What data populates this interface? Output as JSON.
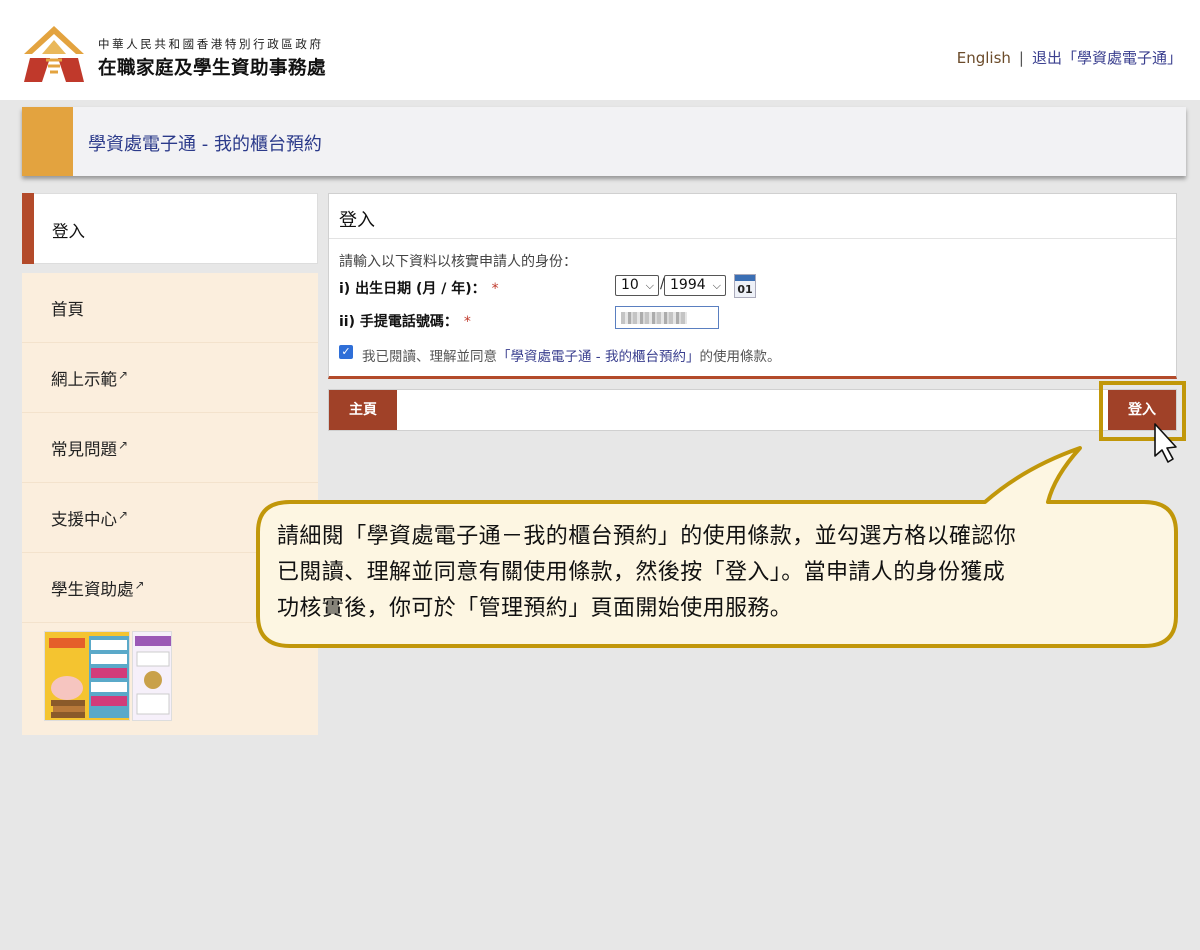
{
  "header": {
    "org_top": "中華人民共和國香港特別行政區政府",
    "org_main": "在職家庭及學生資助事務處",
    "lang_link": "English",
    "separator": "|",
    "logout_link": "退出「學資處電子通」"
  },
  "title_bar": {
    "title": "學資處電子通 - 我的櫃台預約"
  },
  "sidebar": {
    "active_item": "登入",
    "items": [
      {
        "label": "首頁",
        "external": false
      },
      {
        "label": "網上示範",
        "external": true
      },
      {
        "label": "常見問題",
        "external": true
      },
      {
        "label": "支援中心",
        "external": true
      },
      {
        "label": "學生資助處",
        "external": true
      }
    ],
    "external_icon": "external-link-icon"
  },
  "login": {
    "heading": "登入",
    "instruction": "請輸入以下資料以核實申請人的身份：",
    "dob_label": "i) 出生日期 (月 / 年)：",
    "required_mark": "*",
    "month_value": "10",
    "slash": "/",
    "year_value": "1994",
    "calendar_day": "01",
    "phone_label": "ii) 手提電話號碼：",
    "checkbox_checked": true,
    "agree_prefix": "我已閱讀、理解並同意",
    "agree_link": "「學資處電子通 - 我的櫃台預約」",
    "agree_suffix": "的使用條款。"
  },
  "actions": {
    "home_button": "主頁",
    "login_button": "登入"
  },
  "callout": {
    "lines": [
      "請細閱「學資處電子通－我的櫃台預約」的使用條款，並勾選方格以確認你",
      "已閱讀、理解並同意有關使用條款，然後按「登入」。當申請人的身份獲成",
      "功核實後，你可於「管理預約」頁面開始使用服務。"
    ]
  },
  "colors": {
    "accent_orange": "#e3a33f",
    "brand_red": "#a04128",
    "highlight_gold": "#c1970a",
    "callout_fill": "#fdf6e2",
    "sidebar_bg": "#fbeedd"
  }
}
